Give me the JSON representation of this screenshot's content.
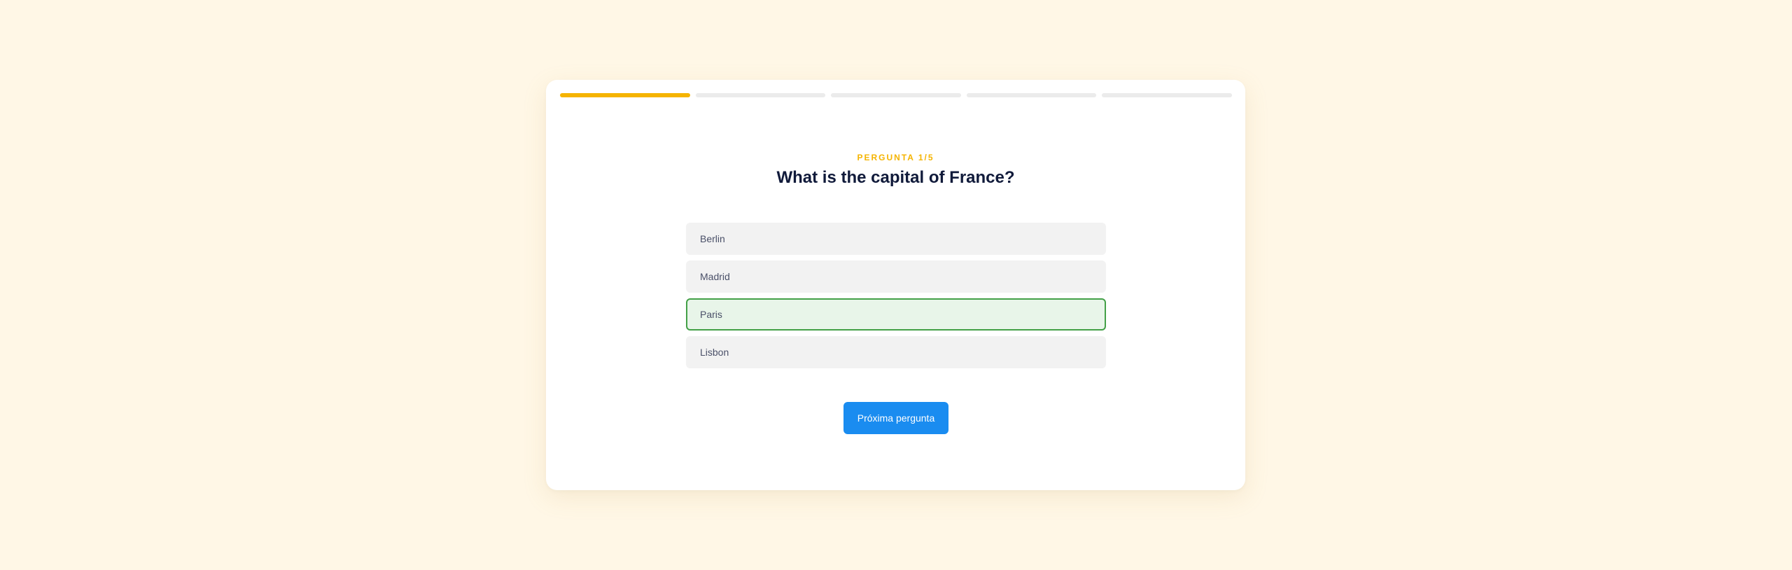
{
  "quiz": {
    "progress": {
      "total_steps": 5,
      "current_step": 1
    },
    "eyebrow": "PERGUNTA 1/5",
    "question": "What is the capital of France?",
    "options": [
      {
        "label": "Berlin",
        "state": "default"
      },
      {
        "label": "Madrid",
        "state": "default"
      },
      {
        "label": "Paris",
        "state": "correct"
      },
      {
        "label": "Lisbon",
        "state": "default"
      }
    ],
    "next_button_label": "Próxima pergunta"
  },
  "colors": {
    "background": "#fff7e6",
    "accent": "#f5b400",
    "progress_inactive": "#ebebeb",
    "question_text": "#101a3a",
    "option_bg": "#f2f2f2",
    "correct_bg": "#e8f5e9",
    "correct_border": "#43a047",
    "primary_button": "#1a8cf0"
  }
}
